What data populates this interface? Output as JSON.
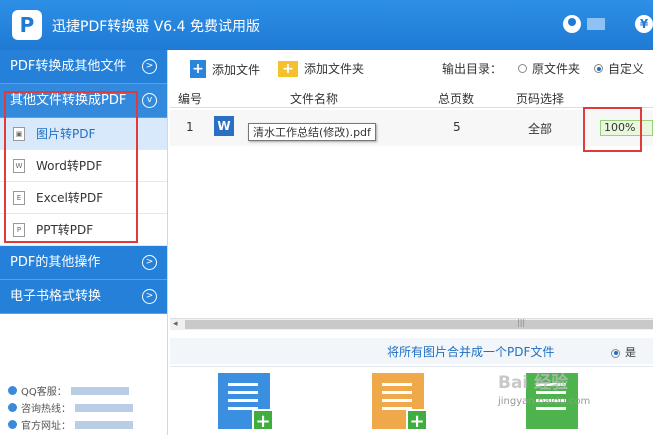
{
  "titlebar": {
    "logo_letter": "P",
    "title": "迅捷PDF转换器 V6.4 免费试用版"
  },
  "sidebar": {
    "cat1": "PDF转换成其他文件",
    "cat2": "其他文件转换成PDF",
    "sub": [
      "图片转PDF",
      "Word转PDF",
      "Excel转PDF",
      "PPT转PDF"
    ],
    "cat3": "PDF的其他操作",
    "cat4": "电子书格式转换",
    "support": [
      "QQ客服：",
      "咨询热线：",
      "官方网址："
    ]
  },
  "toolbar": {
    "add_file": "添加文件",
    "add_folder": "添加文件夹",
    "output_label": "输出目录：",
    "opt_original": "原文件夹",
    "opt_custom": "自定义"
  },
  "table": {
    "headers": [
      "编号",
      "文件名称",
      "总页数",
      "页码选择"
    ],
    "row": {
      "index": "1",
      "file_icon": "W",
      "tooltip": "清水工作总结(修改).pdf",
      "pages": "5",
      "range": "全部",
      "status": "100%"
    }
  },
  "merge": {
    "text": "将所有图片合并成一个PDF文件",
    "yes": "是"
  },
  "watermark": {
    "main": "Bai 经验",
    "sub": "jingyan.baidu.com"
  }
}
